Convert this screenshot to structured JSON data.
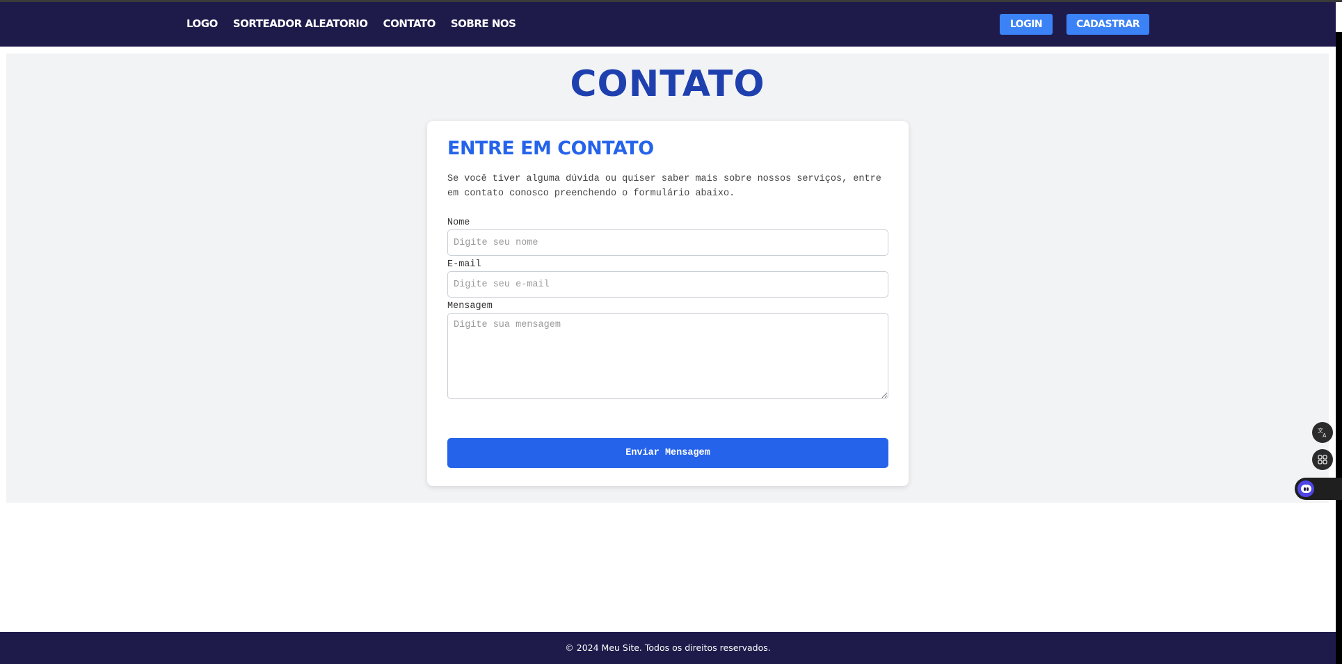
{
  "nav": {
    "links": [
      "LOGO",
      "SORTEADOR ALEATORIO",
      "CONTATO",
      "SOBRE NOS"
    ],
    "login_label": "LOGIN",
    "signup_label": "CADASTRAR"
  },
  "page": {
    "title": "CONTATO"
  },
  "form": {
    "heading": "ENTRE EM CONTATO",
    "description": "Se você tiver alguma dúvida ou quiser saber mais sobre nossos serviços, entre em contato conosco preenchendo o formulário abaixo.",
    "name_label": "Nome",
    "name_placeholder": "Digite seu nome",
    "name_value": "",
    "email_label": "E-mail",
    "email_placeholder": "Digite seu e-mail",
    "email_value": "",
    "message_label": "Mensagem",
    "message_placeholder": "Digite sua mensagem",
    "message_value": "",
    "submit_label": "Enviar Mensagem"
  },
  "footer": {
    "text": "© 2024 Meu Site. Todos os direitos reservados."
  },
  "floating": {
    "translate_icon": "translate-icon",
    "apps_icon": "apps-grid-icon",
    "assistant_icon": "assistant-icon"
  },
  "colors": {
    "navbar": "#1e1b4b",
    "accent": "#2563eb",
    "nav_button": "#3b82f6",
    "title": "#1e40af",
    "section_bg": "#f2f3f5"
  }
}
